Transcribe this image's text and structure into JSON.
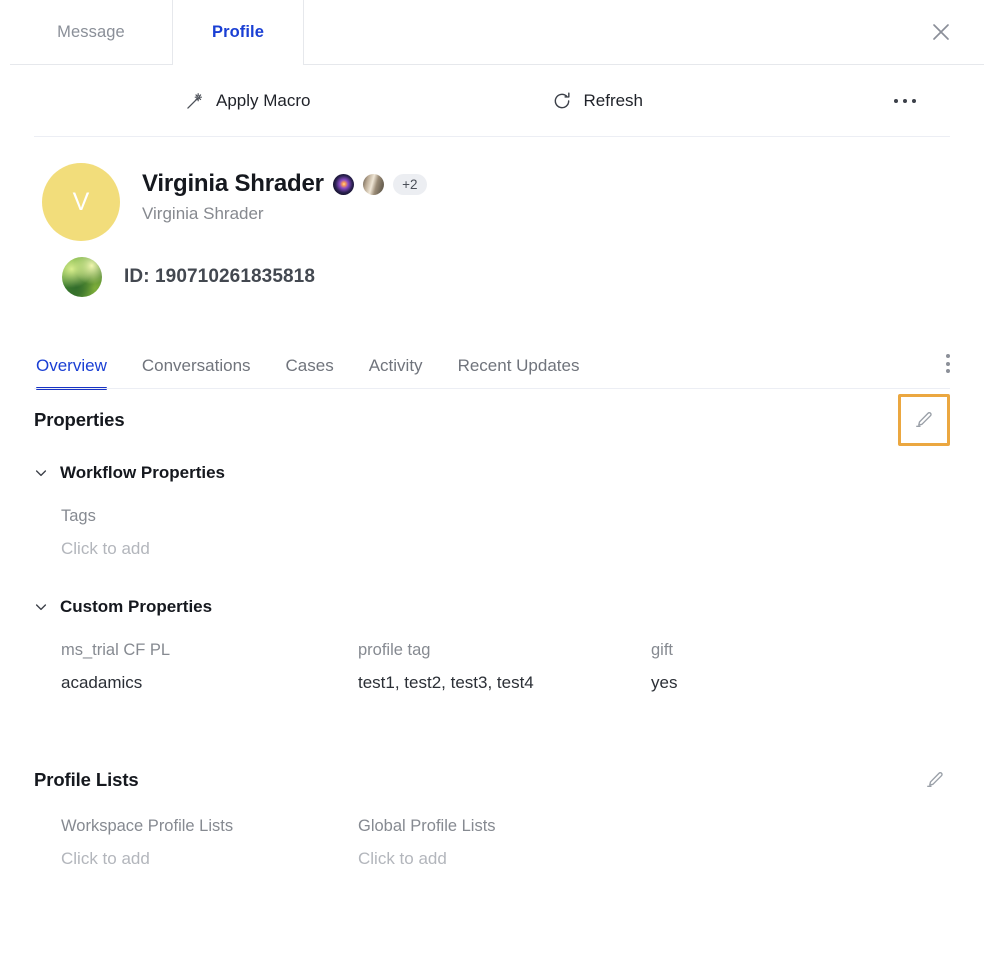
{
  "window_tabs": [
    {
      "label": "Message",
      "active": false
    },
    {
      "label": "Profile",
      "active": true
    }
  ],
  "close_icon": "close-icon",
  "actionbar": {
    "apply_macro": "Apply Macro",
    "apply_macro_icon": "magic-wand-icon",
    "refresh": "Refresh",
    "refresh_icon": "refresh-icon",
    "overflow_icon": "more-horizontal-icon"
  },
  "profile": {
    "avatar_initial": "V",
    "avatar_color": "#f2dd7b",
    "name": "Virginia Shrader",
    "subtitle": "Virginia Shrader",
    "channel_more_count": "+2",
    "id_label": "ID: 190710261835818"
  },
  "section_tabs": [
    {
      "label": "Overview",
      "active": true
    },
    {
      "label": "Conversations",
      "active": false
    },
    {
      "label": "Cases",
      "active": false
    },
    {
      "label": "Activity",
      "active": false
    },
    {
      "label": "Recent Updates",
      "active": false
    }
  ],
  "section_tabs_overflow_icon": "more-vertical-icon",
  "properties": {
    "title": "Properties",
    "edit_icon": "pencil-edit-icon",
    "edit_highlight_color": "#eba740",
    "workflow": {
      "group_label": "Workflow Properties",
      "chevron_icon": "chevron-down-icon",
      "fields": [
        {
          "label": "Tags",
          "value": "Click to add",
          "placeholder": true
        }
      ]
    },
    "custom": {
      "group_label": "Custom Properties",
      "chevron_icon": "chevron-down-icon",
      "fields": [
        {
          "label": "ms_trial CF PL",
          "value": "acadamics",
          "placeholder": false
        },
        {
          "label": "profile tag",
          "value": "test1, test2, test3, test4",
          "placeholder": false
        },
        {
          "label": "gift",
          "value": "yes",
          "placeholder": false
        }
      ]
    }
  },
  "profile_lists": {
    "title": "Profile Lists",
    "edit_icon": "pencil-edit-icon",
    "fields": [
      {
        "label": "Workspace Profile Lists",
        "value": "Click to add",
        "placeholder": true
      },
      {
        "label": "Global Profile Lists",
        "value": "Click to add",
        "placeholder": true
      }
    ]
  },
  "colors": {
    "accent_blue": "#1a3fd4",
    "tab_underline": "#1833c4",
    "highlight_orange": "#eba740",
    "divider": "#eceef4"
  }
}
